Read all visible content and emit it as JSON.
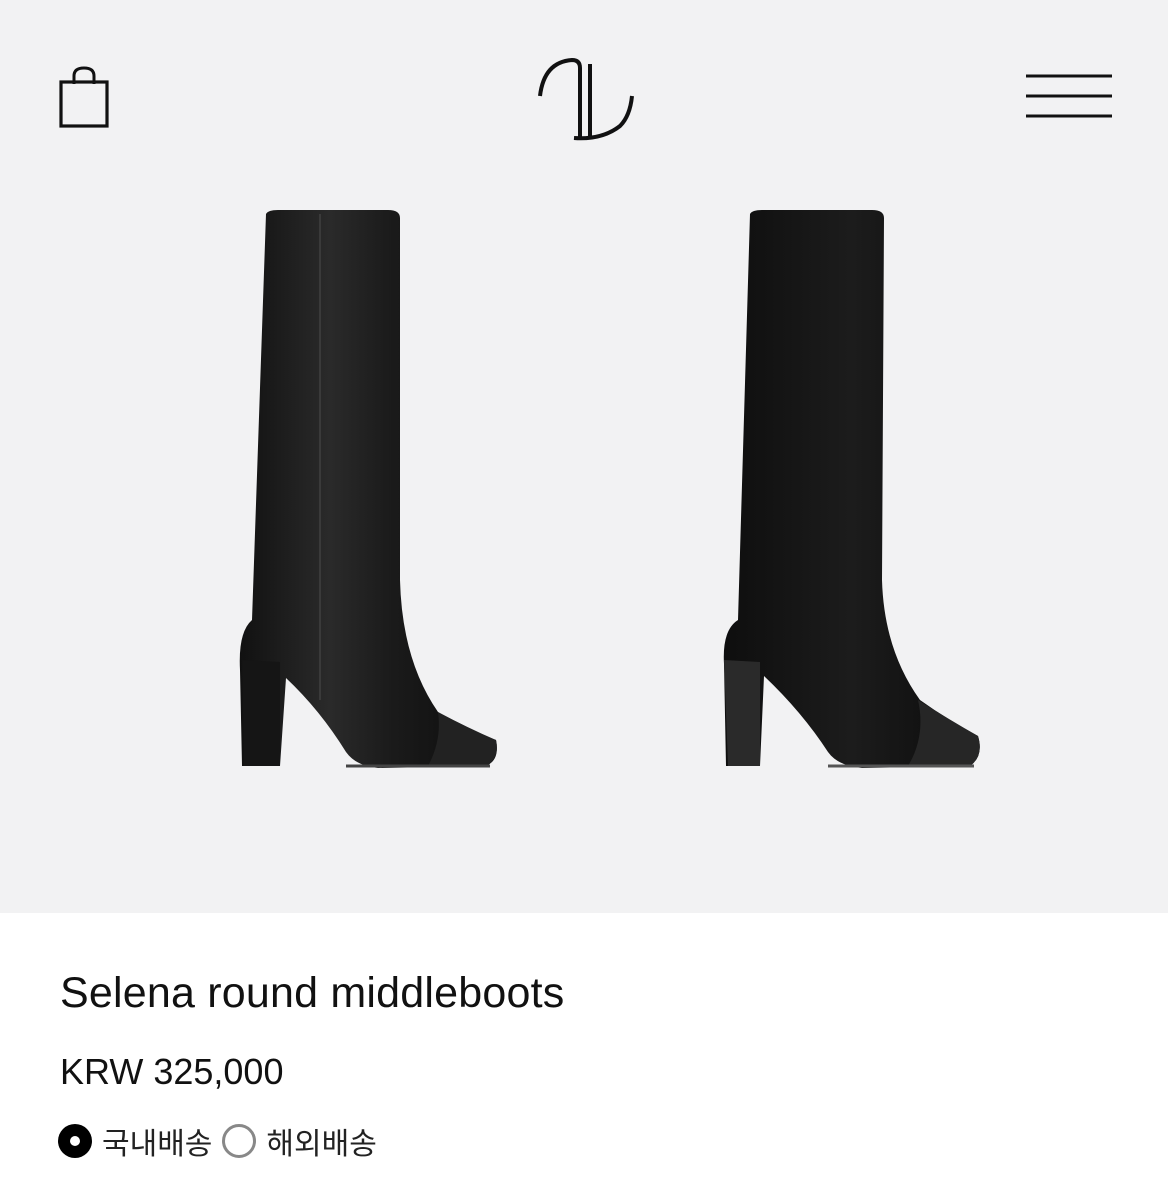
{
  "header": {
    "bag_icon": "shopping-bag-icon",
    "logo_icon": "brand-monogram-logo",
    "menu_icon": "hamburger-menu-icon"
  },
  "gallery": {
    "images": [
      {
        "name": "boot-leather-black"
      },
      {
        "name": "boot-suede-black"
      }
    ]
  },
  "product": {
    "title": "Selena round middleboots",
    "price": "KRW 325,000",
    "shipping": [
      {
        "label": "국내배송",
        "selected": true
      },
      {
        "label": "해외배송",
        "selected": false
      }
    ]
  },
  "colors": {
    "hero_bg": "#f2f2f3",
    "text": "#111111",
    "radio_off": "#888888"
  }
}
